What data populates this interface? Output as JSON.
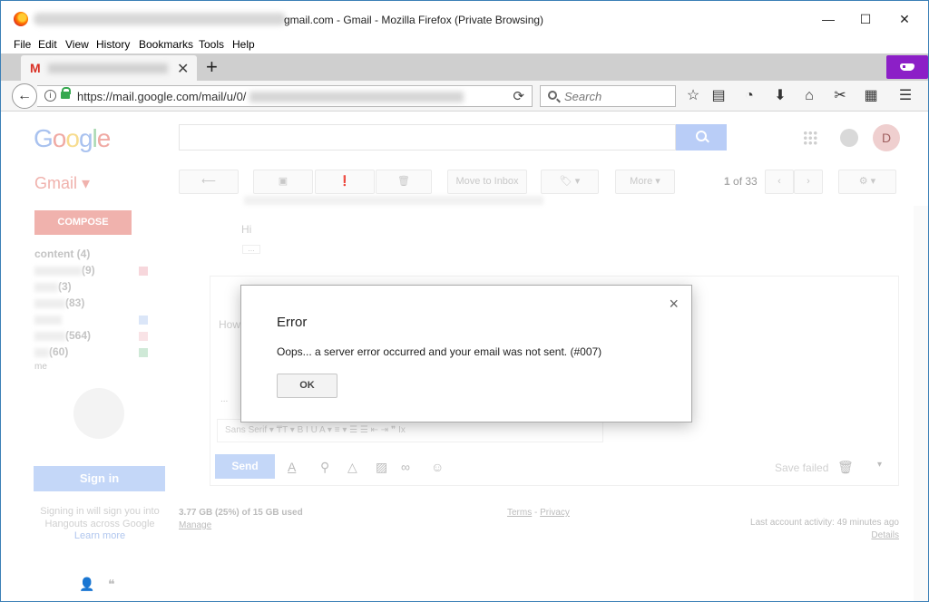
{
  "window": {
    "title": "gmail.com - Gmail - Mozilla Firefox (Private Browsing)",
    "minimize": "—",
    "maximize": "☐",
    "close": "✕"
  },
  "menu": [
    "File",
    "Edit",
    "View",
    "History",
    "Bookmarks",
    "Tools",
    "Help"
  ],
  "tabs": {
    "close": "✕",
    "new_tab": "+"
  },
  "nav": {
    "back": "←",
    "url": "https://mail.google.com/mail/u/0/",
    "reload": "⟳",
    "search_placeholder": "Search"
  },
  "gmail": {
    "logo": [
      "G",
      "o",
      "o",
      "g",
      "l",
      "e"
    ],
    "logo_colors": [
      "#a9c2ef",
      "#f0aaa4",
      "#f7dc8f",
      "#a9c2ef",
      "#a8d8b1",
      "#f0aaa4"
    ],
    "avatar_letter": "D",
    "label": "Gmail ▾",
    "toolbar": {
      "back": "⟵",
      "archive": "▣",
      "spam": "❗",
      "delete": "🗑",
      "move_to_inbox": "Move to Inbox",
      "labels": "🏷 ▾",
      "more": "More ▾",
      "settings": "⚙ ▾",
      "prev": "‹",
      "next": "›"
    },
    "pager": {
      "current": "1",
      "of_total": "of 33"
    },
    "compose": "COMPOSE",
    "sidebar": [
      {
        "label": "content (4)",
        "swatch": ""
      },
      {
        "label": "(9)",
        "swatch": "#f7d7dc"
      },
      {
        "label": "(3)",
        "swatch": ""
      },
      {
        "label": "(83)",
        "swatch": ""
      },
      {
        "label": "",
        "swatch": "#dbe6f8"
      },
      {
        "label": "(564)",
        "swatch": "#f9e3e6"
      },
      {
        "label": "(60)",
        "swatch": "#cfe9d7"
      }
    ],
    "sidebar_more": "me",
    "email": {
      "greeting": "Hi",
      "dots": "...",
      "reply_placeholder": "How",
      "editor_dots": "..."
    },
    "format_bar": "Sans Serif  ▾  ₸T ▾   B   I   U   A ▾   ≡ ▾   ☰   ☰   ⇤   ⇥   ❞   Ix",
    "send": "Send",
    "save_failed": "Save failed",
    "compose_tools": {
      "format": "A",
      "attach": "⚲",
      "drive": "△",
      "photo": "▨",
      "link": "∞",
      "emoji": "☺",
      "trash": "🗑",
      "more": "▾"
    },
    "hangouts": {
      "signin": "Sign in",
      "signin_text": "Signing in will sign you into Hangouts across Google",
      "learn_more": "Learn more"
    },
    "footer": {
      "storage": "3.77 GB (25%) of 15 GB used",
      "manage": "Manage",
      "terms": "Terms",
      "separator": " - ",
      "privacy": "Privacy",
      "last_activity": "Last account activity: 49 minutes ago",
      "details": "Details"
    }
  },
  "dialog": {
    "close": "×",
    "title": "Error",
    "message": "Oops... a server error occurred and your email was not sent. (#007)",
    "ok": "OK"
  }
}
